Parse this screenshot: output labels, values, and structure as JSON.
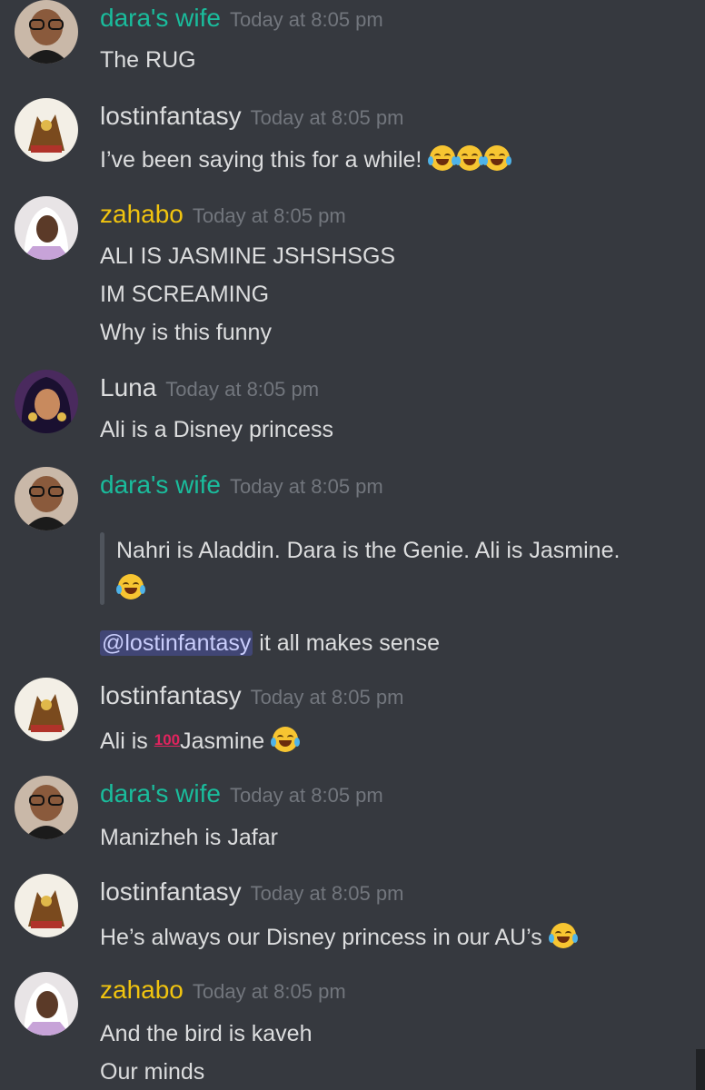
{
  "colors": {
    "background": "#36393f",
    "timestamp": "#72767d",
    "dara_wife": "#1abc9c",
    "lostinfantasy": "#dcddde",
    "zahabo": "#f1c40f",
    "luna": "#dcddde",
    "mention_bg": "#414675"
  },
  "messages": [
    {
      "username": "dara's wife",
      "timestamp": "Today at 8:05 pm",
      "lines": [
        "The RUG"
      ]
    },
    {
      "username": "lostinfantasy",
      "timestamp": "Today at 8:05 pm",
      "lines": [
        "I’ve been saying this for a while!"
      ],
      "emojis": "face-with-tears-of-joy x3"
    },
    {
      "username": "zahabo",
      "timestamp": "Today at 8:05 pm",
      "lines": [
        "ALI IS JASMINE JSHSHSGS",
        "IM SCREAMING",
        "Why is this funny"
      ]
    },
    {
      "username": "Luna",
      "timestamp": "Today at 8:05 pm",
      "lines": [
        "Ali is a Disney princess"
      ]
    },
    {
      "username": "dara's wife",
      "timestamp": "Today at 8:05 pm",
      "quote": "Nahri is Aladdin. Dara is the Genie. Ali is Jasmine.",
      "mention": "@lostinfantasy",
      "after_mention": " it all makes sense"
    },
    {
      "username": "lostinfantasy",
      "timestamp": "Today at 8:05 pm",
      "pre": "Ali is ",
      "hundred": "100",
      "post": "Jasmine"
    },
    {
      "username": "dara's wife",
      "timestamp": "Today at 8:05 pm",
      "lines": [
        "Manizheh is Jafar"
      ]
    },
    {
      "username": "lostinfantasy",
      "timestamp": "Today at 8:05 pm",
      "lines": [
        "He’s always our Disney princess in our AU’s"
      ]
    },
    {
      "username": "zahabo",
      "timestamp": "Today at 8:05 pm",
      "lines": [
        "And the bird is kaveh",
        "Our minds"
      ]
    }
  ]
}
